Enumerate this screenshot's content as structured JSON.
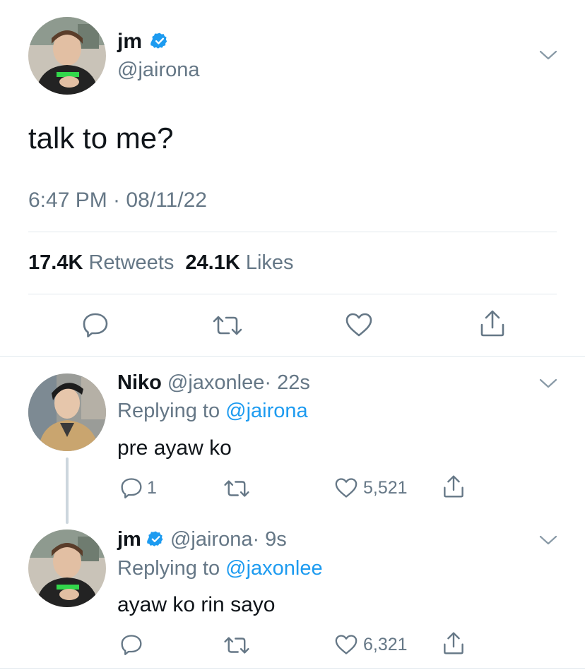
{
  "main_tweet": {
    "name": "jm",
    "handle": "@jairona",
    "text": "talk to me?",
    "timestamp": "6:47 PM · 08/11/22",
    "retweets_count": "17.4K",
    "retweets_label": "Retweets",
    "likes_count": "24.1K",
    "likes_label": "Likes"
  },
  "replies": [
    {
      "name": "Niko",
      "handle": "@jaxonlee",
      "time": "· 22s",
      "replying_prefix": "Replying to",
      "replying_to": "@jairona",
      "text": "pre ayaw ko",
      "reply_count": "1",
      "like_count": "5,521"
    },
    {
      "name": "jm",
      "handle": "@jairona",
      "time": "· 9s",
      "replying_prefix": "Replying to",
      "replying_to": "@jaxonlee",
      "text": "ayaw ko rin sayo",
      "reply_count": "",
      "like_count": "6,321"
    }
  ],
  "colors": {
    "accent": "#1d9bf0",
    "secondary_text": "#657786",
    "divider": "#e1e8ed"
  },
  "icons": [
    "verified-badge-icon",
    "chevron-down-icon",
    "reply-icon",
    "retweet-icon",
    "like-icon",
    "share-icon"
  ]
}
